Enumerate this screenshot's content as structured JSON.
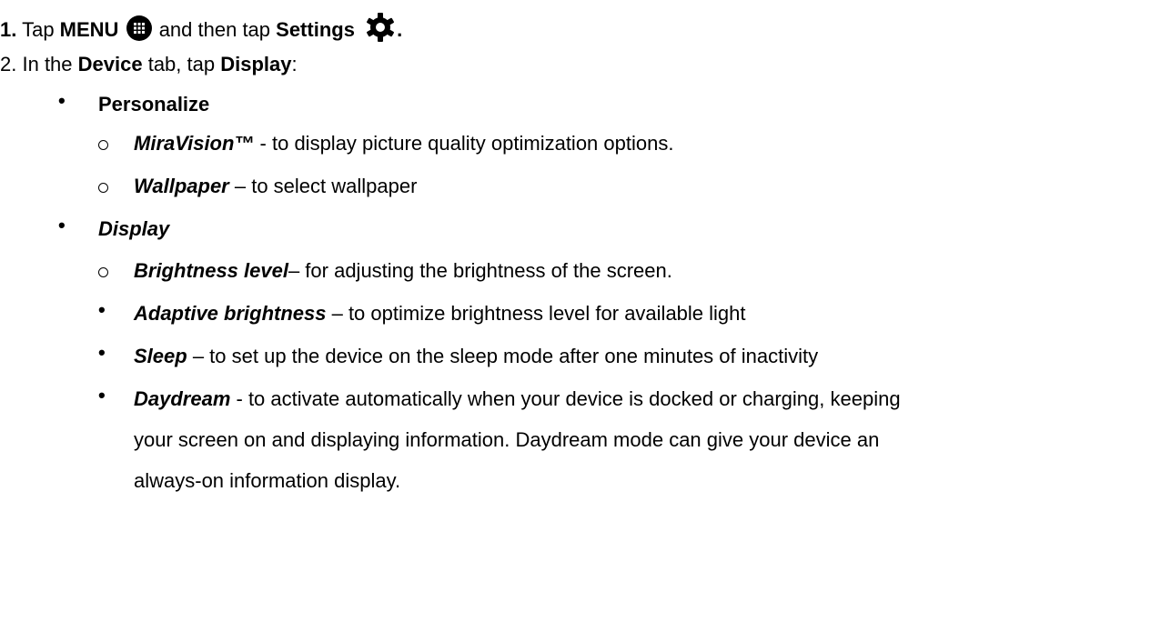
{
  "step1": {
    "number": "1.",
    "tap1": "Tap ",
    "menu": "MENU",
    "and_then": " and then tap ",
    "settings": "Settings",
    "period": "."
  },
  "step2": {
    "number": "2.",
    "in_the": "In the ",
    "device": "Device",
    "tab_tap": " tab, tap ",
    "display": "Display",
    "colon": ":"
  },
  "personalize": {
    "heading": "Personalize",
    "items": [
      {
        "term": "MiraVision™",
        "desc": " - to display picture quality optimization options."
      },
      {
        "term": "Wallpaper",
        "desc": " – to select wallpaper"
      }
    ]
  },
  "display_section": {
    "heading": "Display",
    "brightness": {
      "term": "Brightness level",
      "desc": "– for adjusting the brightness of the screen."
    },
    "items": [
      {
        "term": "Adaptive brightness",
        "desc": " – to optimize brightness level for available light"
      },
      {
        "term": "Sleep",
        "desc": " – to set up the device on the sleep mode after one minutes of inactivity"
      },
      {
        "term": "Daydream",
        "desc": " - to activate automatically when your device is docked or charging, keeping"
      }
    ],
    "daydream_cont1": "your screen on and displaying information. Daydream mode can give your device an",
    "daydream_cont2": "always-on information display."
  },
  "icons": {
    "menu": "grid-menu-icon",
    "settings": "gear-icon"
  }
}
